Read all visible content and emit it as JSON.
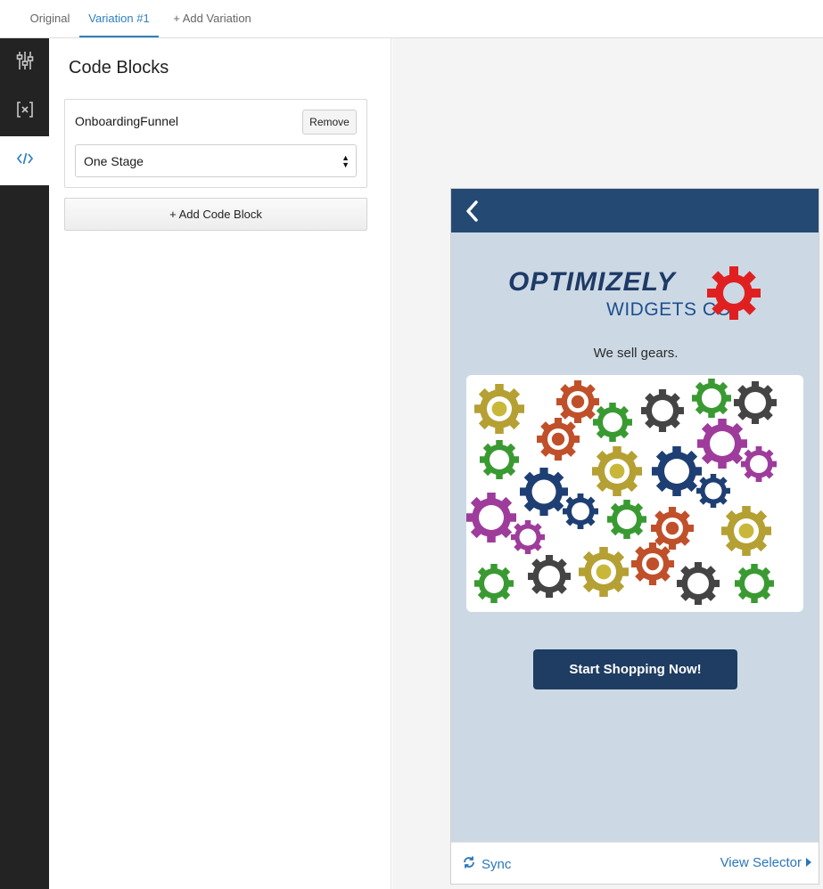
{
  "tabs": [
    {
      "label": "Original",
      "active": false
    },
    {
      "label": "Variation #1",
      "active": true
    },
    {
      "label": "+ Add Variation",
      "active": false
    }
  ],
  "rail": {
    "items": [
      {
        "icon": "sliders-icon",
        "active": false
      },
      {
        "icon": "variable-brackets-icon",
        "active": false
      },
      {
        "icon": "code-icon",
        "active": true
      }
    ]
  },
  "panel": {
    "title": "Code Blocks",
    "block": {
      "name": "OnboardingFunnel",
      "remove_label": "Remove",
      "selected_option": "One Stage"
    },
    "add_block_label": "+ Add Code Block"
  },
  "preview": {
    "logo_line1": "OPTIMIZELY",
    "logo_line2": "WIDGETS CO",
    "tagline": "We sell gears.",
    "cta_label": "Start Shopping Now!",
    "sync_label": "Sync",
    "view_selector_label": "View Selector"
  },
  "colors": {
    "accent": "#2f80c2",
    "rail": "#232323",
    "appbar": "#244a74",
    "device_bg": "#ccd9e5",
    "cta": "#1f3c62",
    "logo_gear": "#e02020"
  }
}
